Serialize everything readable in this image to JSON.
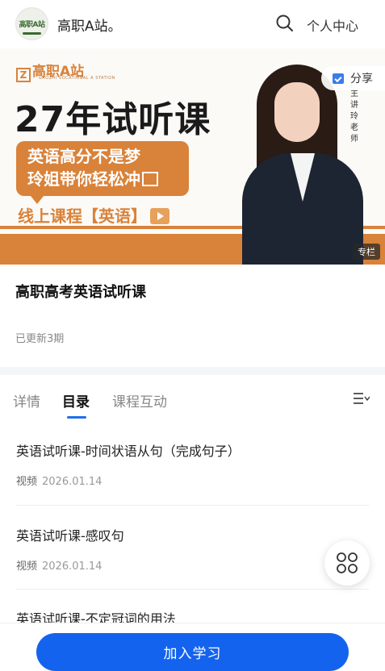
{
  "header": {
    "logo_text": "高职A站",
    "site_name": "高职A站。",
    "user_center": "个人中心"
  },
  "banner": {
    "logo": "高职A站",
    "logo_sub": "GAOZHI VOCATIONAL A STATION",
    "title": "27年试听课",
    "slogan_line1": "英语高分不是梦",
    "slogan_line2": "玲姐带你轻松冲",
    "subtitle": "线上课程【英语】",
    "teacher_tag": "主讲玲老师",
    "share_label": "分享",
    "column_badge": "专栏",
    "accent_color": "#d9823a"
  },
  "course": {
    "title": "高职高考英语试听课",
    "updated": "已更新3期"
  },
  "tabs": {
    "items": [
      {
        "label": "详情",
        "active": false
      },
      {
        "label": "目录",
        "active": true
      },
      {
        "label": "课程互动",
        "active": false
      }
    ],
    "menu_icon": "list-menu-icon"
  },
  "lessons": [
    {
      "title": "英语试听课-时间状语从句（完成句子）",
      "type": "视频",
      "date": "2026.01.14"
    },
    {
      "title": "英语试听课-感叹句",
      "type": "视频",
      "date": "2026.01.14"
    },
    {
      "title": "英语试听课-不定冠词的用法",
      "type": "",
      "date": ""
    }
  ],
  "floating": {
    "icon": "grid-apps-icon"
  },
  "bottom": {
    "join_label": "加入学习",
    "button_color": "#1463ef"
  }
}
